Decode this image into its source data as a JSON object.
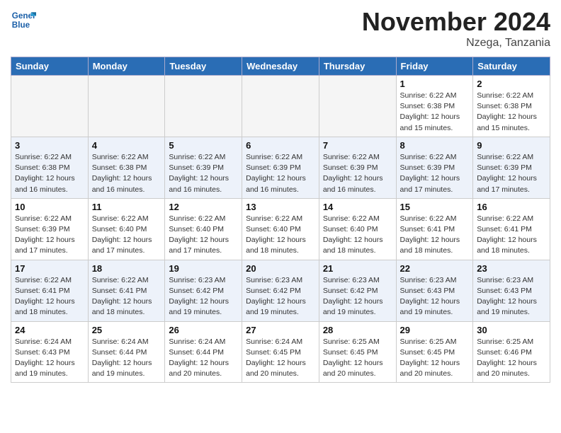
{
  "header": {
    "logo_line1": "General",
    "logo_line2": "Blue",
    "month_title": "November 2024",
    "location": "Nzega, Tanzania"
  },
  "weekdays": [
    "Sunday",
    "Monday",
    "Tuesday",
    "Wednesday",
    "Thursday",
    "Friday",
    "Saturday"
  ],
  "weeks": [
    [
      {
        "day": "",
        "info": ""
      },
      {
        "day": "",
        "info": ""
      },
      {
        "day": "",
        "info": ""
      },
      {
        "day": "",
        "info": ""
      },
      {
        "day": "",
        "info": ""
      },
      {
        "day": "1",
        "info": "Sunrise: 6:22 AM\nSunset: 6:38 PM\nDaylight: 12 hours\nand 15 minutes."
      },
      {
        "day": "2",
        "info": "Sunrise: 6:22 AM\nSunset: 6:38 PM\nDaylight: 12 hours\nand 15 minutes."
      }
    ],
    [
      {
        "day": "3",
        "info": "Sunrise: 6:22 AM\nSunset: 6:38 PM\nDaylight: 12 hours\nand 16 minutes."
      },
      {
        "day": "4",
        "info": "Sunrise: 6:22 AM\nSunset: 6:38 PM\nDaylight: 12 hours\nand 16 minutes."
      },
      {
        "day": "5",
        "info": "Sunrise: 6:22 AM\nSunset: 6:39 PM\nDaylight: 12 hours\nand 16 minutes."
      },
      {
        "day": "6",
        "info": "Sunrise: 6:22 AM\nSunset: 6:39 PM\nDaylight: 12 hours\nand 16 minutes."
      },
      {
        "day": "7",
        "info": "Sunrise: 6:22 AM\nSunset: 6:39 PM\nDaylight: 12 hours\nand 16 minutes."
      },
      {
        "day": "8",
        "info": "Sunrise: 6:22 AM\nSunset: 6:39 PM\nDaylight: 12 hours\nand 17 minutes."
      },
      {
        "day": "9",
        "info": "Sunrise: 6:22 AM\nSunset: 6:39 PM\nDaylight: 12 hours\nand 17 minutes."
      }
    ],
    [
      {
        "day": "10",
        "info": "Sunrise: 6:22 AM\nSunset: 6:39 PM\nDaylight: 12 hours\nand 17 minutes."
      },
      {
        "day": "11",
        "info": "Sunrise: 6:22 AM\nSunset: 6:40 PM\nDaylight: 12 hours\nand 17 minutes."
      },
      {
        "day": "12",
        "info": "Sunrise: 6:22 AM\nSunset: 6:40 PM\nDaylight: 12 hours\nand 17 minutes."
      },
      {
        "day": "13",
        "info": "Sunrise: 6:22 AM\nSunset: 6:40 PM\nDaylight: 12 hours\nand 18 minutes."
      },
      {
        "day": "14",
        "info": "Sunrise: 6:22 AM\nSunset: 6:40 PM\nDaylight: 12 hours\nand 18 minutes."
      },
      {
        "day": "15",
        "info": "Sunrise: 6:22 AM\nSunset: 6:41 PM\nDaylight: 12 hours\nand 18 minutes."
      },
      {
        "day": "16",
        "info": "Sunrise: 6:22 AM\nSunset: 6:41 PM\nDaylight: 12 hours\nand 18 minutes."
      }
    ],
    [
      {
        "day": "17",
        "info": "Sunrise: 6:22 AM\nSunset: 6:41 PM\nDaylight: 12 hours\nand 18 minutes."
      },
      {
        "day": "18",
        "info": "Sunrise: 6:22 AM\nSunset: 6:41 PM\nDaylight: 12 hours\nand 18 minutes."
      },
      {
        "day": "19",
        "info": "Sunrise: 6:23 AM\nSunset: 6:42 PM\nDaylight: 12 hours\nand 19 minutes."
      },
      {
        "day": "20",
        "info": "Sunrise: 6:23 AM\nSunset: 6:42 PM\nDaylight: 12 hours\nand 19 minutes."
      },
      {
        "day": "21",
        "info": "Sunrise: 6:23 AM\nSunset: 6:42 PM\nDaylight: 12 hours\nand 19 minutes."
      },
      {
        "day": "22",
        "info": "Sunrise: 6:23 AM\nSunset: 6:43 PM\nDaylight: 12 hours\nand 19 minutes."
      },
      {
        "day": "23",
        "info": "Sunrise: 6:23 AM\nSunset: 6:43 PM\nDaylight: 12 hours\nand 19 minutes."
      }
    ],
    [
      {
        "day": "24",
        "info": "Sunrise: 6:24 AM\nSunset: 6:43 PM\nDaylight: 12 hours\nand 19 minutes."
      },
      {
        "day": "25",
        "info": "Sunrise: 6:24 AM\nSunset: 6:44 PM\nDaylight: 12 hours\nand 19 minutes."
      },
      {
        "day": "26",
        "info": "Sunrise: 6:24 AM\nSunset: 6:44 PM\nDaylight: 12 hours\nand 20 minutes."
      },
      {
        "day": "27",
        "info": "Sunrise: 6:24 AM\nSunset: 6:45 PM\nDaylight: 12 hours\nand 20 minutes."
      },
      {
        "day": "28",
        "info": "Sunrise: 6:25 AM\nSunset: 6:45 PM\nDaylight: 12 hours\nand 20 minutes."
      },
      {
        "day": "29",
        "info": "Sunrise: 6:25 AM\nSunset: 6:45 PM\nDaylight: 12 hours\nand 20 minutes."
      },
      {
        "day": "30",
        "info": "Sunrise: 6:25 AM\nSunset: 6:46 PM\nDaylight: 12 hours\nand 20 minutes."
      }
    ]
  ]
}
